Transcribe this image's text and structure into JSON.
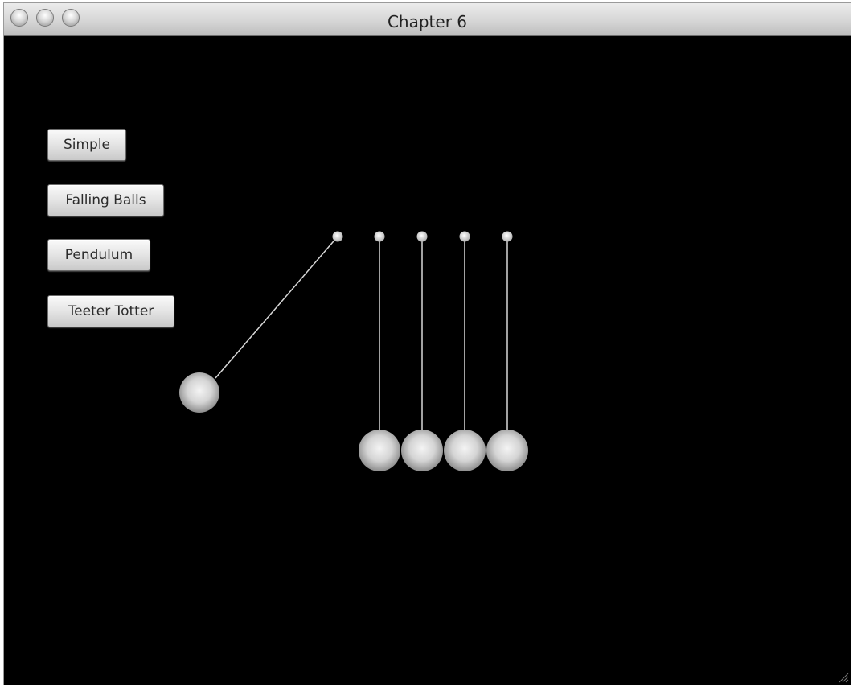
{
  "window": {
    "title": "Chapter 6"
  },
  "buttons": [
    {
      "label": "Simple"
    },
    {
      "label": "Falling Balls"
    },
    {
      "label": "Pendulum"
    },
    {
      "label": "Teeter Totter"
    }
  ],
  "colors": {
    "background": "#000000",
    "string": "#d8d8d8",
    "ball": "#d0d0d0"
  }
}
